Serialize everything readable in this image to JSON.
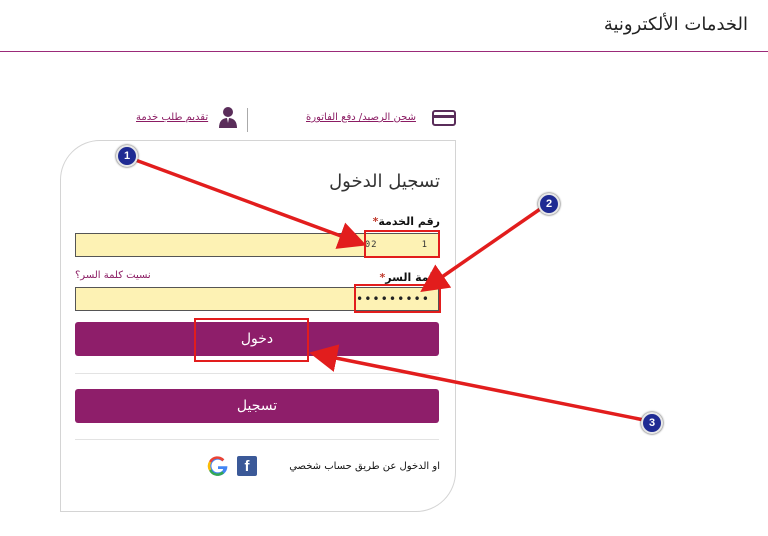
{
  "header": {
    "title": "الخدمات الألكترونية"
  },
  "toplinks": {
    "recharge_label": "شحن الرصيد/ دفع الفاتورة",
    "request_label": "تقديم طلب خدمة"
  },
  "card": {
    "title": "تسجيل الدخول",
    "service_label": "رقم الخدمة",
    "password_label": "كلمة السر",
    "required_mark": "*",
    "forgot_label": "نسيت كلمة السر؟",
    "service_value_start": "02",
    "service_value_end": "1",
    "password_value": "•••••••••",
    "login_button": "دخول",
    "register_button": "تسجيل",
    "social_text": "او الدخول عن طريق حساب شخصي",
    "facebook_glyph": "f"
  },
  "annotations": [
    "1",
    "2",
    "3"
  ],
  "colors": {
    "brand": "#8e1e6a",
    "input_bg": "#fdf2b4",
    "highlight": "#e21d1d",
    "badge": "#1f2b93"
  }
}
